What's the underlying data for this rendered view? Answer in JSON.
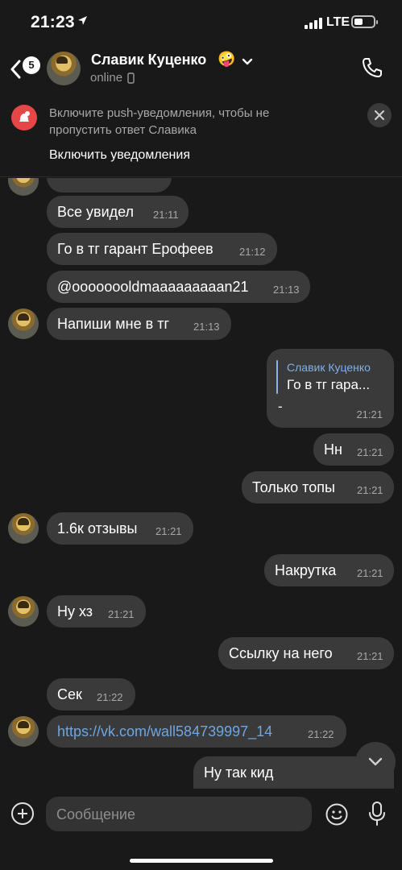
{
  "status_bar": {
    "time": "21:23",
    "location_icon": "location-arrow-icon",
    "network": "LTE"
  },
  "header": {
    "back_badge": "5",
    "contact_name": "Славик Куценко",
    "emoji": "🤪",
    "status": "online",
    "icons": [
      "back-chevron-icon",
      "chevron-down-icon",
      "mobile-device-icon",
      "phone-icon"
    ]
  },
  "banner": {
    "text": "Включите push-уведомления, чтобы не пропустить ответ Славика",
    "action": "Включить уведомления"
  },
  "messages": [
    {
      "dir": "in",
      "text": "Все увидел",
      "time": "21:11"
    },
    {
      "dir": "in",
      "text": "Го в тг гарант Ерофеев",
      "time": "21:12"
    },
    {
      "dir": "in",
      "text": "@oooooooldmaaaaaaaaan21",
      "time": "21:13"
    },
    {
      "dir": "in",
      "text": "Напиши мне в тг",
      "time": "21:13"
    },
    {
      "dir": "out",
      "reply_to_name": "Славик Куценко",
      "reply_to_text": "Го в тг гара...",
      "text": "-",
      "time": "21:21"
    },
    {
      "dir": "out",
      "text": "Нн",
      "time": "21:21"
    },
    {
      "dir": "out",
      "text": "Только топы",
      "time": "21:21"
    },
    {
      "dir": "in",
      "text": "1.6к отзывы",
      "time": "21:21"
    },
    {
      "dir": "out",
      "text": "Накрутка",
      "time": "21:21"
    },
    {
      "dir": "in",
      "text": "Ну хз",
      "time": "21:21"
    },
    {
      "dir": "out",
      "text": "Ссылку на него",
      "time": "21:21"
    },
    {
      "dir": "in",
      "text": "Сек",
      "time": "21:22"
    },
    {
      "dir": "in",
      "text": "https://vk.com/wall584739997_14",
      "time": "21:22",
      "is_link": true
    },
    {
      "dir": "out",
      "text": "Ну так кид",
      "time": ""
    }
  ],
  "input": {
    "placeholder": "Сообщение"
  },
  "colors": {
    "background": "#191919",
    "bubble": "#3a3a3a",
    "link": "#6fa6e0",
    "notification": "#e64646"
  }
}
